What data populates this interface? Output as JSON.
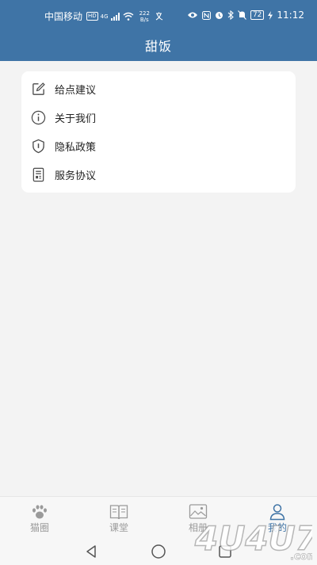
{
  "status": {
    "carrier": "中国移动",
    "hd": "HD",
    "network": "4G",
    "speed_value": "222",
    "speed_unit": "B/s",
    "battery": "72",
    "time": "11:12"
  },
  "header": {
    "title": "甜饭"
  },
  "menu": {
    "items": [
      {
        "label": "给点建议",
        "icon": "edit-icon"
      },
      {
        "label": "关于我们",
        "icon": "info-icon"
      },
      {
        "label": "隐私政策",
        "icon": "shield-icon"
      },
      {
        "label": "服务协议",
        "icon": "document-icon"
      }
    ]
  },
  "tabs": [
    {
      "label": "猫圈",
      "icon": "paw-icon",
      "active": false
    },
    {
      "label": "课堂",
      "icon": "book-icon",
      "active": false
    },
    {
      "label": "相册",
      "icon": "image-icon",
      "active": false
    },
    {
      "label": "我的",
      "icon": "user-icon",
      "active": true
    }
  ],
  "colors": {
    "accent": "#3f74a6",
    "background": "#f3f3f3",
    "card": "#ffffff"
  },
  "watermark": {
    "text": "4U4U7",
    "suffix": ".com"
  }
}
